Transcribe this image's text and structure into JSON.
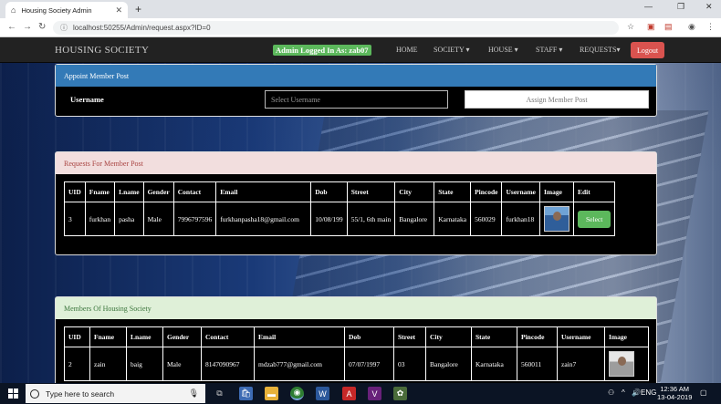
{
  "browser": {
    "tab_title": "Housing Society Admin",
    "url": "localhost:50255/Admin/request.aspx?ID=0",
    "new_tab": "+",
    "win_minimize": "—",
    "win_maximize": "❐",
    "win_close": "✕"
  },
  "navbar": {
    "brand": "HOUSING SOCIETY",
    "admin_badge": "Admin Logged In As: zab07",
    "items": [
      "HOME",
      "SOCIETY ▾",
      "HOUSE ▾",
      "STAFF ▾",
      "REQUESTS▾"
    ],
    "logout": "Logout"
  },
  "appoint_panel": {
    "heading": "Appoint Member Post",
    "username_label": "Username",
    "select_placeholder": "Select Username",
    "assign_button": "Assign Member Post"
  },
  "requests_panel": {
    "heading": "Requests For Member Post",
    "columns": [
      "UID",
      "Fname",
      "Lname",
      "Gender",
      "Contact",
      "Email",
      "Dob",
      "Street",
      "City",
      "State",
      "Pincode",
      "Username",
      "Image",
      "Edit"
    ],
    "rows": [
      {
        "uid": "3",
        "fname": "furkhan",
        "lname": "pasha",
        "gender": "Male",
        "contact": "7996797596",
        "email": "furkhanpasha18@gmail.com",
        "dob": "10/08/199",
        "street": "55/1, 6th main",
        "city": "Bangalore",
        "state": "Karnataka",
        "pincode": "560029",
        "username": "furkhan18",
        "edit": "Select"
      }
    ]
  },
  "members_panel": {
    "heading": "Members Of Housing Society",
    "columns": [
      "UID",
      "Fname",
      "Lname",
      "Gender",
      "Contact",
      "Email",
      "Dob",
      "Street",
      "City",
      "State",
      "Pincode",
      "Username",
      "Image"
    ],
    "rows": [
      {
        "uid": "2",
        "fname": "zain",
        "lname": "baig",
        "gender": "Male",
        "contact": "8147090967",
        "email": "mdzab777@gmail.com",
        "dob": "07/07/1997",
        "street": "03",
        "city": "Bangalore",
        "state": "Karnataka",
        "pincode": "560011",
        "username": "zain7"
      }
    ]
  },
  "taskbar": {
    "search_placeholder": "Type here to search",
    "language": "ENG",
    "time": "12:36 AM",
    "date": "13-04-2019"
  }
}
